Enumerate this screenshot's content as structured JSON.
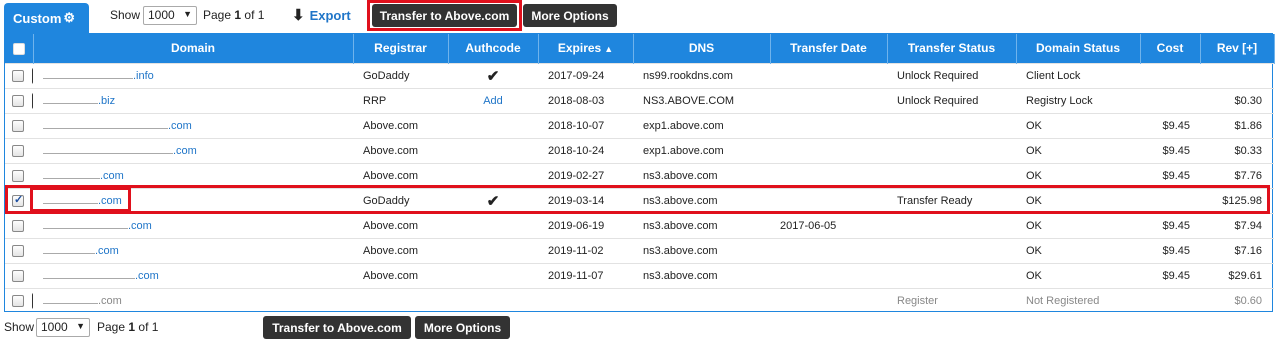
{
  "toolbar": {
    "tab_label": "Custom",
    "show_label": "Show",
    "page_size": "1000",
    "page_prefix": "Page",
    "page_current": "1",
    "page_of": "of",
    "page_total": "1",
    "export_label": "Export",
    "transfer_label": "Transfer to Above.com",
    "more_label": "More Options"
  },
  "columns": {
    "domain": "Domain",
    "registrar": "Registrar",
    "authcode": "Authcode",
    "expires": "Expires",
    "dns": "DNS",
    "transfer_date": "Transfer Date",
    "transfer_status": "Transfer Status",
    "domain_status": "Domain Status",
    "cost": "Cost",
    "rev": "Rev [+]"
  },
  "labels": {
    "transfer_to_above": "Transfer to Above",
    "at_above": "at Above"
  },
  "colors": {
    "header_blue": "#1f86de",
    "link_blue": "#1f75c8",
    "highlight_red": "#e0101c",
    "dark_button": "#333333",
    "ok_green": "#34a83a"
  },
  "rows": [
    {
      "checked": false,
      "action": "Transfer to Above",
      "domain": ".info",
      "registrar": "GoDaddy",
      "authcode": "check",
      "expires": "2017-09-24",
      "dns": "ns99.rookdns.com",
      "transfer_date": "",
      "transfer_status": "Unlock Required",
      "domain_status": "Client Lock",
      "cost": "",
      "rev": ""
    },
    {
      "checked": false,
      "action": "Transfer to Above",
      "domain": ".biz",
      "registrar": "RRP",
      "authcode": "Add",
      "expires": "2018-08-03",
      "dns": "NS3.ABOVE.COM",
      "transfer_date": "",
      "transfer_status": "Unlock Required",
      "domain_status": "Registry Lock",
      "cost": "",
      "rev": "$0.30"
    },
    {
      "checked": false,
      "action": "at Above",
      "domain": ".com",
      "registrar": "Above.com",
      "authcode": "",
      "expires": "2018-10-07",
      "dns": "exp1.above.com",
      "transfer_date": "",
      "transfer_status": "",
      "domain_status": "OK",
      "cost": "$9.45",
      "rev": "$1.86"
    },
    {
      "checked": false,
      "action": "at Above",
      "domain": ".com",
      "registrar": "Above.com",
      "authcode": "",
      "expires": "2018-10-24",
      "dns": "exp1.above.com",
      "transfer_date": "",
      "transfer_status": "",
      "domain_status": "OK",
      "cost": "$9.45",
      "rev": "$0.33"
    },
    {
      "checked": false,
      "action": "at Above",
      "domain": ".com",
      "registrar": "Above.com",
      "authcode": "",
      "expires": "2019-02-27",
      "dns": "ns3.above.com",
      "transfer_date": "",
      "transfer_status": "",
      "domain_status": "OK",
      "cost": "$9.45",
      "rev": "$7.76"
    },
    {
      "checked": true,
      "action": "Transfer to Above",
      "domain": ".com",
      "registrar": "GoDaddy",
      "authcode": "check",
      "expires": "2019-03-14",
      "dns": "ns3.above.com",
      "transfer_date": "",
      "transfer_status": "Transfer Ready",
      "domain_status": "OK",
      "cost": "",
      "rev": "$125.98"
    },
    {
      "checked": false,
      "action": "at Above",
      "domain": ".com",
      "registrar": "Above.com",
      "authcode": "",
      "expires": "2019-06-19",
      "dns": "ns3.above.com",
      "transfer_date": "2017-06-05",
      "transfer_status": "",
      "domain_status": "OK",
      "cost": "$9.45",
      "rev": "$7.94"
    },
    {
      "checked": false,
      "action": "at Above",
      "domain": ".com",
      "registrar": "Above.com",
      "authcode": "",
      "expires": "2019-11-02",
      "dns": "ns3.above.com",
      "transfer_date": "",
      "transfer_status": "",
      "domain_status": "OK",
      "cost": "$9.45",
      "rev": "$7.16"
    },
    {
      "checked": false,
      "action": "at Above",
      "domain": ".com",
      "registrar": "Above.com",
      "authcode": "",
      "expires": "2019-11-07",
      "dns": "ns3.above.com",
      "transfer_date": "",
      "transfer_status": "",
      "domain_status": "OK",
      "cost": "$9.45",
      "rev": "$29.61"
    },
    {
      "checked": false,
      "action": "Transfer to Above",
      "domain": ".com",
      "registrar": "",
      "authcode": "",
      "expires": "",
      "dns": "",
      "transfer_date": "",
      "transfer_status": "Register",
      "domain_status": "Not Registered",
      "cost": "",
      "rev": "$0.60"
    }
  ]
}
